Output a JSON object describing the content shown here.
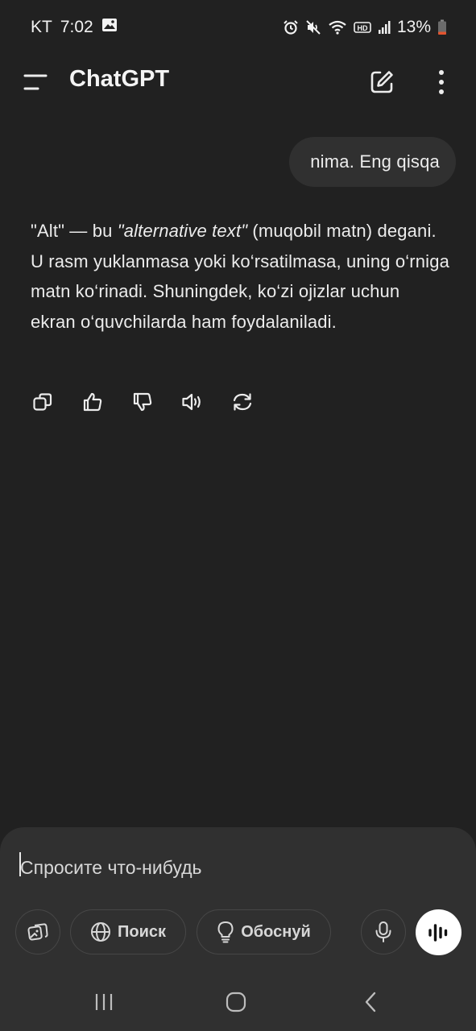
{
  "status_bar": {
    "carrier": "KT",
    "time": "7:02",
    "battery": "13%",
    "icons": [
      "gallery-icon",
      "alarm-icon",
      "mute-icon",
      "wifi-icon",
      "hd-icon",
      "signal-icon",
      "battery-icon"
    ]
  },
  "app_bar": {
    "title": "ChatGPT",
    "icons": [
      "menu-icon",
      "new-chat-icon",
      "more-vert-icon"
    ]
  },
  "conversation": {
    "user_message": "nima. Eng qisqa",
    "assistant": {
      "p1_quote_alt": "\"Alt\" — bu ",
      "p1_italic": "\"alternative text\"",
      "p1_rest": " (muqobil matn) degani. U rasm yuklanmasa yoki ko‘rsatilmasa, uning o‘rniga matn ko‘rinadi. Shuningdek, ko‘zi ojizlar uchun ekran o‘quvchilarda ham foydalaniladi."
    },
    "actions": [
      "copy-icon",
      "thumbs-up-icon",
      "thumbs-down-icon",
      "read-aloud-icon",
      "regenerate-icon"
    ]
  },
  "composer": {
    "placeholder": "Спросите что-нибудь",
    "search_label": "Поиск",
    "reason_label": "Обоснуй",
    "icons": [
      "attach-image-icon",
      "globe-icon",
      "lightbulb-icon",
      "mic-icon",
      "voice-waveform-icon"
    ]
  },
  "nav_bar": {
    "icons": [
      "recent-apps-icon",
      "home-icon",
      "back-icon"
    ]
  },
  "colors": {
    "background": "#212121",
    "bubble": "#303030",
    "composer": "#303030",
    "text": "#ececec",
    "voice_button": "#ffffff"
  }
}
